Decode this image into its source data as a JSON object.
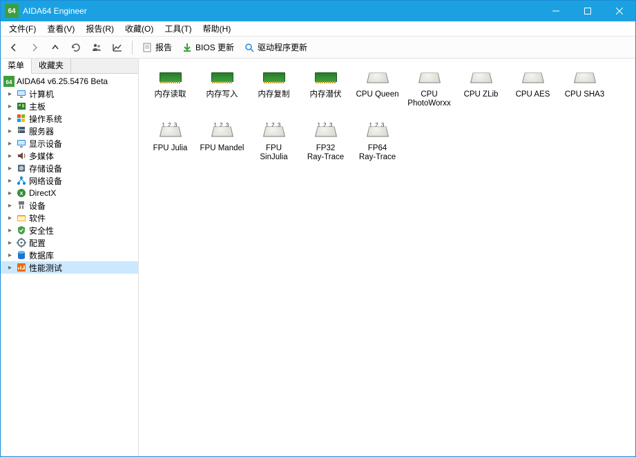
{
  "window": {
    "title": "AIDA64 Engineer",
    "app_icon_text": "64"
  },
  "menubar": [
    "文件(F)",
    "查看(V)",
    "报告(R)",
    "收藏(O)",
    "工具(T)",
    "帮助(H)"
  ],
  "toolbar": {
    "report": "报告",
    "bios": "BIOS 更新",
    "driver": "驱动程序更新"
  },
  "tabs": {
    "menu": "菜单",
    "fav": "收藏夹"
  },
  "tree": {
    "root": "AIDA64 v6.25.5476 Beta",
    "items": [
      {
        "label": "计算机",
        "icon": "monitor",
        "color": "#1e88e5"
      },
      {
        "label": "主板",
        "icon": "board",
        "color": "#2e7d32"
      },
      {
        "label": "操作系统",
        "icon": "windows",
        "color": "#0078d7"
      },
      {
        "label": "服务器",
        "icon": "server",
        "color": "#455a64"
      },
      {
        "label": "显示设备",
        "icon": "monitor",
        "color": "#1e88e5"
      },
      {
        "label": "多媒体",
        "icon": "speaker",
        "color": "#6d4c41"
      },
      {
        "label": "存储设备",
        "icon": "disk",
        "color": "#546e7a"
      },
      {
        "label": "网络设备",
        "icon": "network",
        "color": "#0288d1"
      },
      {
        "label": "DirectX",
        "icon": "dx",
        "color": "#388e3c"
      },
      {
        "label": "设备",
        "icon": "device",
        "color": "#757575"
      },
      {
        "label": "软件",
        "icon": "software",
        "color": "#f9a825"
      },
      {
        "label": "安全性",
        "icon": "shield",
        "color": "#43a047"
      },
      {
        "label": "配置",
        "icon": "config",
        "color": "#607d8b"
      },
      {
        "label": "数据库",
        "icon": "db",
        "color": "#1976d2"
      },
      {
        "label": "性能测试",
        "icon": "bench",
        "color": "#ef6c00",
        "selected": true
      }
    ]
  },
  "benchmarks": {
    "row1": [
      {
        "label": "内存读取",
        "type": "ram"
      },
      {
        "label": "内存写入",
        "type": "ram"
      },
      {
        "label": "内存复制",
        "type": "ram"
      },
      {
        "label": "内存潜伏",
        "type": "ram"
      },
      {
        "label": "CPU Queen",
        "type": "cpu"
      },
      {
        "label": "CPU PhotoWorxx",
        "type": "cpu"
      },
      {
        "label": "CPU ZLib",
        "type": "cpu"
      },
      {
        "label": "CPU AES",
        "type": "cpu"
      },
      {
        "label": "CPU SHA3",
        "type": "cpu"
      }
    ],
    "row2": [
      {
        "label": "FPU Julia",
        "type": "fpu"
      },
      {
        "label": "FPU Mandel",
        "type": "fpu"
      },
      {
        "label": "FPU SinJulia",
        "type": "fpu"
      },
      {
        "label": "FP32 Ray-Trace",
        "type": "fpu"
      },
      {
        "label": "FP64 Ray-Trace",
        "type": "fpu"
      }
    ]
  }
}
